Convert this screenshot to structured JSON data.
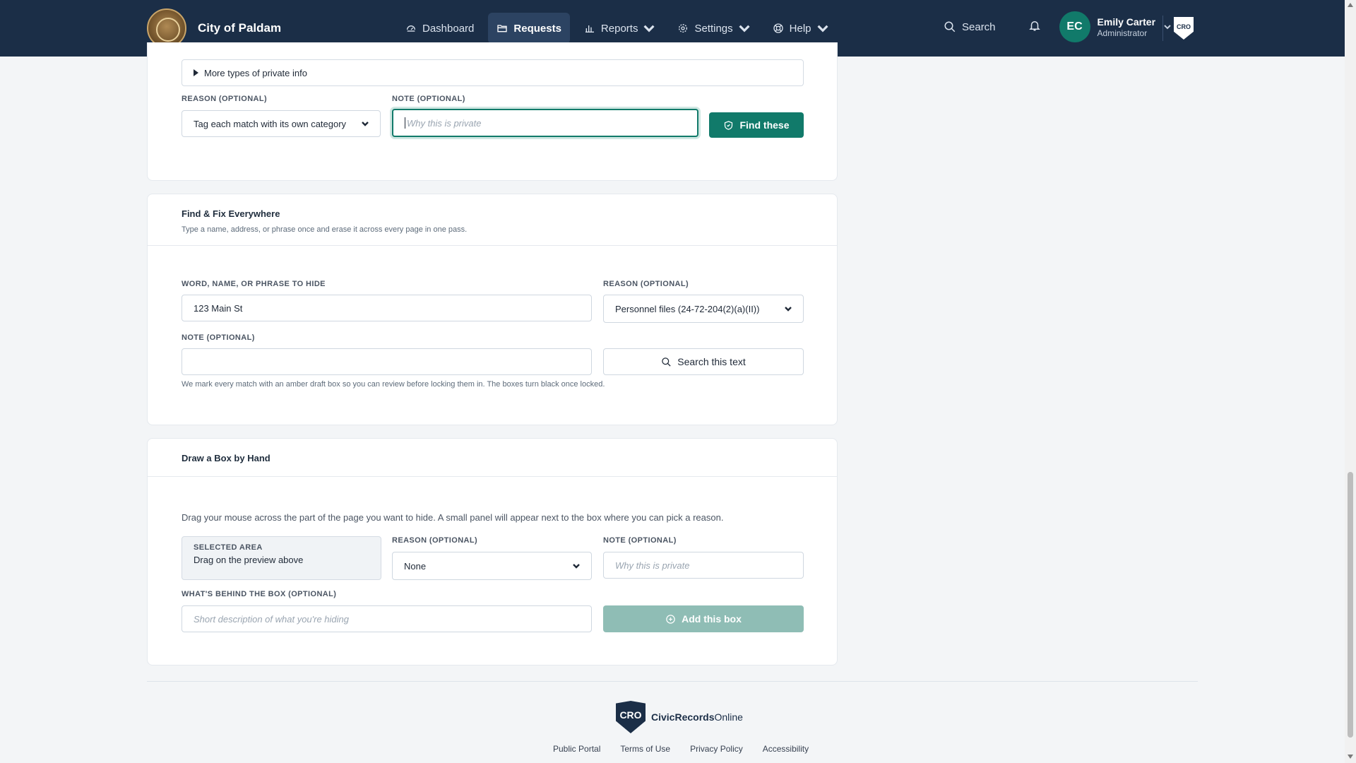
{
  "header": {
    "city_name": "City of Paldam",
    "nav": [
      {
        "label": "Dashboard",
        "icon": "dashboard-icon"
      },
      {
        "label": "Requests",
        "icon": "folder-icon",
        "active": true
      },
      {
        "label": "Reports",
        "icon": "bar-chart-icon"
      },
      {
        "label": "Settings",
        "icon": "gear-icon"
      },
      {
        "label": "Help",
        "icon": "help-icon"
      }
    ],
    "search_label": "Search",
    "user": {
      "initials": "EC",
      "name": "Emily Carter",
      "role": "Administrator"
    },
    "badge": "CRO"
  },
  "pii_section": {
    "more_types": "More types of private info",
    "reason_label": "REASON (OPTIONAL)",
    "reason_value": "Tag each match with its own category",
    "note_label": "NOTE (OPTIONAL)",
    "note_placeholder": "Why this is private",
    "find_button": "Find these"
  },
  "find_fix": {
    "title": "Find & Fix Everywhere",
    "subtitle": "Type a name, address, or phrase once and erase it across every page in one pass.",
    "phrase_label": "WORD, NAME, OR PHRASE TO HIDE",
    "phrase_value": "123 Main St",
    "reason_label": "REASON (OPTIONAL)",
    "reason_value": "Personnel files (24-72-204(2)(a)(II))",
    "note_label": "NOTE (OPTIONAL)",
    "note_value": "",
    "search_button": "Search this text",
    "hint": "We mark every match with an amber draft box so you can review before locking them in. The boxes turn black once locked."
  },
  "draw_box": {
    "title": "Draw a Box by Hand",
    "instructions": "Drag your mouse across the part of the page you want to hide. A small panel will appear next to the box where you can pick a reason.",
    "selected_label": "SELECTED AREA",
    "selected_value": "Drag on the preview above",
    "reason_label": "REASON (OPTIONAL)",
    "reason_value": "None",
    "note_label": "NOTE (OPTIONAL)",
    "note_placeholder": "Why this is private",
    "behind_label": "WHAT'S BEHIND THE BOX (OPTIONAL)",
    "behind_placeholder": "Short description of what you're hiding",
    "add_button": "Add this box"
  },
  "footer": {
    "logo_text": "CRO",
    "brand_bold": "CivicRecords",
    "brand_rest": "Online",
    "links": [
      "Public Portal",
      "Terms of Use",
      "Privacy Policy",
      "Accessibility"
    ]
  },
  "colors": {
    "nav_bg": "#1b2e47",
    "accent": "#117a6a",
    "page_bg": "#f3f5f7"
  }
}
